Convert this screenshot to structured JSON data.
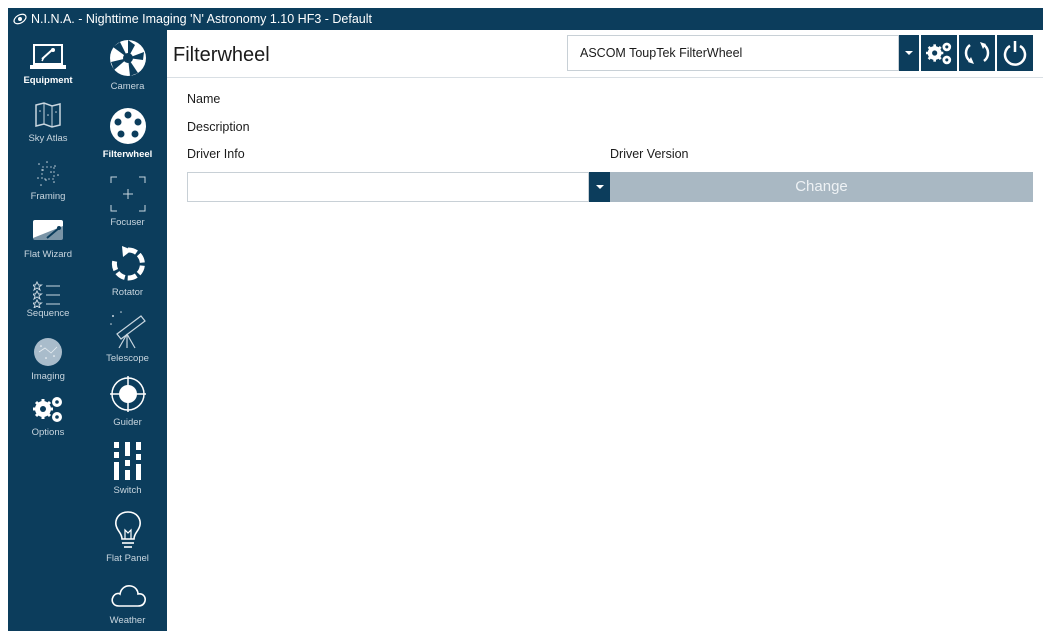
{
  "window": {
    "title": "N.I.N.A. - Nighttime Imaging 'N' Astronomy 1.10 HF3   -  Default"
  },
  "left_nav": {
    "items": [
      {
        "label": "Equipment",
        "icon": "laptop-telescope-icon",
        "active": true
      },
      {
        "label": "Sky Atlas",
        "icon": "sky-atlas-icon"
      },
      {
        "label": "Framing",
        "icon": "framing-icon"
      },
      {
        "label": "Flat Wizard",
        "icon": "flat-wizard-icon"
      },
      {
        "label": "Sequence",
        "icon": "sequence-icon"
      },
      {
        "label": "Imaging",
        "icon": "imaging-icon"
      },
      {
        "label": "Options",
        "icon": "gears-icon"
      }
    ]
  },
  "sub_nav": {
    "items": [
      {
        "label": "Camera",
        "icon": "aperture-icon"
      },
      {
        "label": "Filterwheel",
        "icon": "filterwheel-icon",
        "active": true
      },
      {
        "label": "Focuser",
        "icon": "focuser-icon"
      },
      {
        "label": "Rotator",
        "icon": "rotator-icon"
      },
      {
        "label": "Telescope",
        "icon": "telescope-icon"
      },
      {
        "label": "Guider",
        "icon": "guider-icon"
      },
      {
        "label": "Switch",
        "icon": "switch-icon"
      },
      {
        "label": "Flat Panel",
        "icon": "lightbulb-icon"
      },
      {
        "label": "Weather",
        "icon": "cloud-icon"
      }
    ]
  },
  "main": {
    "title": "Filterwheel",
    "device_selector": {
      "value": "ASCOM ToupTek FilterWheel"
    },
    "header_buttons": [
      {
        "icon": "settings-gears-icon"
      },
      {
        "icon": "refresh-icon"
      },
      {
        "icon": "power-icon"
      }
    ],
    "fields": {
      "name_label": "Name",
      "description_label": "Description",
      "driver_info_label": "Driver Info",
      "driver_version_label": "Driver Version"
    },
    "driver_select": {
      "value": ""
    },
    "change_button": {
      "label": "Change"
    }
  },
  "colors": {
    "nav_bg": "#0c3d5c",
    "change_button_bg": "#a9b8c3"
  }
}
